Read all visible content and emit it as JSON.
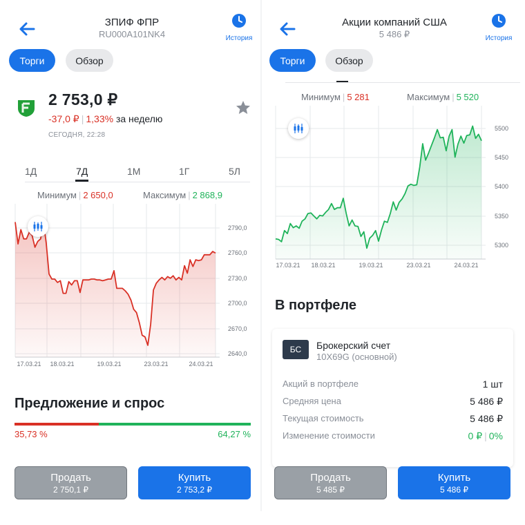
{
  "left": {
    "header": {
      "title": "ЗПИФ ФПР",
      "subtitle": "RU000A101NK4",
      "history_label": "История"
    },
    "tabs": [
      {
        "label": "Торги",
        "active": true
      },
      {
        "label": "Обзор",
        "active": false
      }
    ],
    "asset": {
      "price": "2 753,0 ₽",
      "change_abs": "-37,0 ₽",
      "change_pct": "1,33%",
      "change_period": "за неделю",
      "updated": "СЕГОДНЯ, 22:28",
      "logo_color": "#21a038",
      "favorite_icon": "star-icon"
    },
    "periods": [
      {
        "label": "1Д",
        "active": false
      },
      {
        "label": "7Д",
        "active": true
      },
      {
        "label": "1М",
        "active": false
      },
      {
        "label": "1Г",
        "active": false
      },
      {
        "label": "5Л",
        "active": false
      }
    ],
    "minmax": {
      "min_label": "Минимум",
      "min_value": "2 650,0",
      "max_label": "Максимум",
      "max_value": "2 868,9"
    },
    "chart_data": {
      "type": "area",
      "color": "#d93025",
      "x_ticks": [
        "17.03.21",
        "18.03.21",
        "19.03.21",
        "23.03.21",
        "24.03.21"
      ],
      "y_ticks": [
        "2790,0",
        "2760,0",
        "2730,0",
        "2700,0",
        "2670,0",
        "2640,0"
      ],
      "ylim": [
        2640,
        2790
      ],
      "grid": true,
      "values": [
        2797,
        2771,
        2788,
        2777,
        2777,
        2785,
        2781,
        2767,
        2774,
        2777,
        2798,
        2772,
        2735,
        2729,
        2729,
        2725,
        2727,
        2712,
        2712,
        2726,
        2722,
        2727,
        2727,
        2713,
        2728,
        2728,
        2728,
        2729,
        2729,
        2728,
        2728,
        2727,
        2728,
        2729,
        2729,
        2739,
        2718,
        2718,
        2718,
        2715,
        2711,
        2704,
        2693,
        2689,
        2677,
        2662,
        2660,
        2650,
        2675,
        2716,
        2724,
        2728,
        2731,
        2728,
        2732,
        2730,
        2733,
        2728,
        2731,
        2728,
        2745,
        2736,
        2752,
        2744,
        2752,
        2751,
        2752,
        2758,
        2758,
        2758,
        2762,
        2760
      ]
    },
    "order_book": {
      "title": "Предложение и спрос",
      "sell_pct": "35,73 %",
      "buy_pct": "64,27 %",
      "sell_share": 0.3573
    },
    "buttons": {
      "sell_label": "Продать",
      "sell_price": "2 750,1 ₽",
      "buy_label": "Купить",
      "buy_price": "2 753,2 ₽"
    }
  },
  "right": {
    "header": {
      "title": "Акции компаний США",
      "subtitle": "5 486 ₽",
      "history_label": "История"
    },
    "tabs": [
      {
        "label": "Торги",
        "active": true
      },
      {
        "label": "Обзор",
        "active": false
      }
    ],
    "minmax": {
      "min_label": "Минимум",
      "min_value": "5 281",
      "max_label": "Максимум",
      "max_value": "5 520"
    },
    "chart_data": {
      "type": "area",
      "color": "#1fb35a",
      "x_ticks": [
        "17.03.21",
        "18.03.21",
        "19.03.21",
        "23.03.21",
        "24.03.21"
      ],
      "y_ticks": [
        "5500",
        "5450",
        "5400",
        "5350",
        "5300"
      ],
      "ylim": [
        5280,
        5520
      ],
      "grid": true,
      "values": [
        5318,
        5317,
        5313,
        5332,
        5327,
        5344,
        5337,
        5340,
        5336,
        5348,
        5352,
        5361,
        5362,
        5357,
        5352,
        5358,
        5357,
        5363,
        5368,
        5378,
        5368,
        5371,
        5371,
        5387,
        5361,
        5340,
        5350,
        5340,
        5339,
        5322,
        5330,
        5302,
        5319,
        5324,
        5332,
        5314,
        5333,
        5348,
        5346,
        5361,
        5381,
        5367,
        5380,
        5386,
        5395,
        5408,
        5411,
        5409,
        5410,
        5440,
        5480,
        5452,
        5464,
        5477,
        5490,
        5504,
        5490,
        5491,
        5468,
        5493,
        5504,
        5457,
        5479,
        5493,
        5481,
        5494,
        5495,
        5510,
        5489,
        5496,
        5485
      ]
    },
    "portfolio": {
      "title": "В портфеле",
      "account_badge": "БС",
      "account_name": "Брокерский счет",
      "account_id": "10X69G (основной)",
      "rows": [
        {
          "label": "Акций в портфеле",
          "value": "1 шт"
        },
        {
          "label": "Средняя цена",
          "value": "5 486 ₽"
        },
        {
          "label": "Текущая стоимость",
          "value": "5 486 ₽"
        },
        {
          "label": "Изменение стоимости",
          "value": "0 ₽",
          "value2": "0%"
        }
      ]
    },
    "buttons": {
      "sell_label": "Продать",
      "sell_price": "5 485 ₽",
      "buy_label": "Купить",
      "buy_price": "5 486 ₽"
    }
  }
}
